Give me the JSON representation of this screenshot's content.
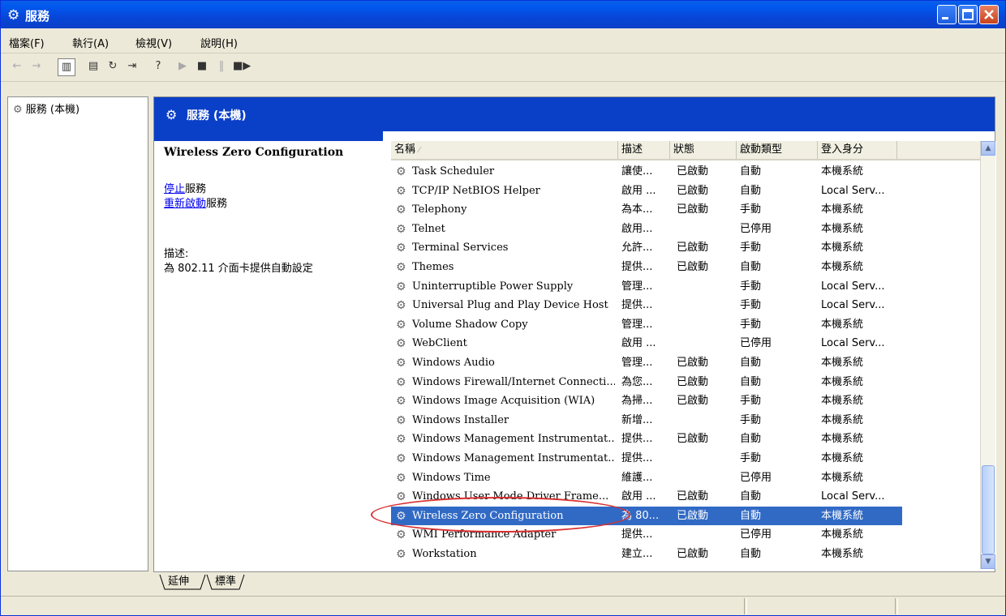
{
  "window": {
    "title": "服務"
  },
  "menu": [
    "檔案(F)",
    "執行(A)",
    "檢視(V)",
    "說明(H)"
  ],
  "tree": {
    "item": "服務 (本機)"
  },
  "banner": {
    "title": "服務 (本機)"
  },
  "details": {
    "service_title": "Wireless Zero Configuration",
    "stop_link": "停止",
    "stop_suffix": "服務",
    "restart_link": "重新啟動",
    "restart_suffix": "服務",
    "desc_label": "描述:",
    "desc_text": "為 802.11 介面卡提供自動設定"
  },
  "columns": [
    "名稱",
    "描述",
    "狀態",
    "啟動類型",
    "登入身分"
  ],
  "services": [
    {
      "name": "Task Scheduler",
      "desc": "讓使...",
      "status": "已啟動",
      "startup": "自動",
      "logon": "本機系統"
    },
    {
      "name": "TCP/IP NetBIOS Helper",
      "desc": "啟用 ...",
      "status": "已啟動",
      "startup": "自動",
      "logon": "Local Serv..."
    },
    {
      "name": "Telephony",
      "desc": "為本...",
      "status": "已啟動",
      "startup": "手動",
      "logon": "本機系統"
    },
    {
      "name": "Telnet",
      "desc": "啟用...",
      "status": "",
      "startup": "已停用",
      "logon": "本機系統"
    },
    {
      "name": "Terminal Services",
      "desc": "允許...",
      "status": "已啟動",
      "startup": "手動",
      "logon": "本機系統"
    },
    {
      "name": "Themes",
      "desc": "提供...",
      "status": "已啟動",
      "startup": "自動",
      "logon": "本機系統"
    },
    {
      "name": "Uninterruptible Power Supply",
      "desc": "管理...",
      "status": "",
      "startup": "手動",
      "logon": "Local Serv..."
    },
    {
      "name": "Universal Plug and Play Device Host",
      "desc": "提供...",
      "status": "",
      "startup": "手動",
      "logon": "Local Serv..."
    },
    {
      "name": "Volume Shadow Copy",
      "desc": "管理...",
      "status": "",
      "startup": "手動",
      "logon": "本機系統"
    },
    {
      "name": "WebClient",
      "desc": "啟用 ...",
      "status": "",
      "startup": "已停用",
      "logon": "Local Serv..."
    },
    {
      "name": "Windows Audio",
      "desc": "管理...",
      "status": "已啟動",
      "startup": "自動",
      "logon": "本機系統"
    },
    {
      "name": "Windows Firewall/Internet Connecti...",
      "desc": "為您...",
      "status": "已啟動",
      "startup": "自動",
      "logon": "本機系統"
    },
    {
      "name": "Windows Image Acquisition (WIA)",
      "desc": "為掃...",
      "status": "已啟動",
      "startup": "手動",
      "logon": "本機系統"
    },
    {
      "name": "Windows Installer",
      "desc": "新增...",
      "status": "",
      "startup": "手動",
      "logon": "本機系統"
    },
    {
      "name": "Windows Management Instrumentat...",
      "desc": "提供...",
      "status": "已啟動",
      "startup": "自動",
      "logon": "本機系統"
    },
    {
      "name": "Windows Management Instrumentat...",
      "desc": "提供...",
      "status": "",
      "startup": "手動",
      "logon": "本機系統"
    },
    {
      "name": "Windows Time",
      "desc": "維護...",
      "status": "",
      "startup": "已停用",
      "logon": "本機系統"
    },
    {
      "name": "Windows User Mode Driver Frame...",
      "desc": "啟用 ...",
      "status": "已啟動",
      "startup": "自動",
      "logon": "Local Serv..."
    },
    {
      "name": "Wireless Zero Configuration",
      "desc": "為 80...",
      "status": "已啟動",
      "startup": "自動",
      "logon": "本機系統",
      "selected": true
    },
    {
      "name": "WMI Performance Adapter",
      "desc": "提供...",
      "status": "",
      "startup": "已停用",
      "logon": "本機系統"
    },
    {
      "name": "Workstation",
      "desc": "建立...",
      "status": "已啟動",
      "startup": "自動",
      "logon": "本機系統"
    }
  ],
  "tabs": [
    "延伸",
    "標準"
  ]
}
